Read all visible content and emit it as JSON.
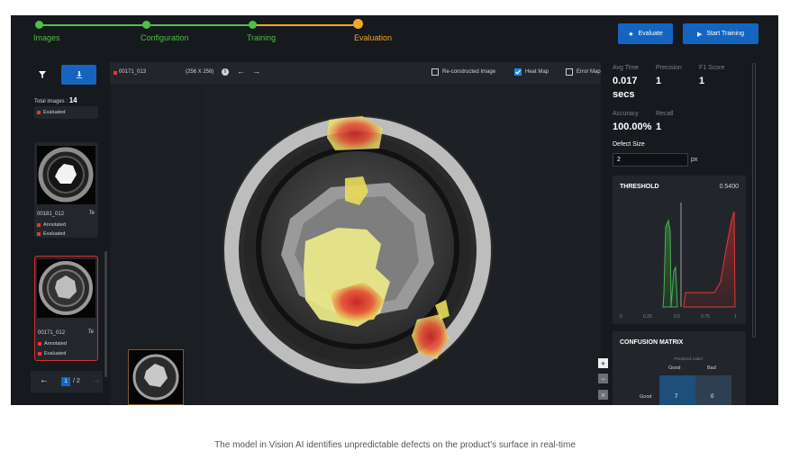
{
  "stepper": {
    "steps": [
      {
        "label": "Images",
        "status": "done"
      },
      {
        "label": "Configuration",
        "status": "done"
      },
      {
        "label": "Training",
        "status": "done"
      },
      {
        "label": "Evaluation",
        "status": "active"
      }
    ],
    "evaluate_label": "Evaluate",
    "start_training_label": "Start Training"
  },
  "sidebar": {
    "total_label": "Total images :",
    "total_count": "14",
    "cards": [
      {
        "name": "",
        "tags": [
          "Evaluated"
        ]
      },
      {
        "name": "00181_012",
        "suffix": "Te",
        "tags": [
          "Annotated",
          "Evaluated"
        ]
      },
      {
        "name": "00171_012",
        "suffix": "Te",
        "tags": [
          "Annotated",
          "Evaluated"
        ],
        "selected": true
      }
    ],
    "pagination": {
      "current": "1",
      "total": "/ 2"
    }
  },
  "viewer": {
    "file_name": "00171_013",
    "dimensions": "(256 X 256)",
    "options": [
      {
        "label": "Re-constructed Image",
        "checked": false
      },
      {
        "label": "Heat Map",
        "checked": true
      },
      {
        "label": "Error Map",
        "checked": false
      }
    ],
    "zoom_in": "+",
    "zoom_out": "−",
    "fit": "×"
  },
  "metrics": {
    "avg_time_label": "Avg Time",
    "avg_time_value": "0.017",
    "avg_time_unit": "secs",
    "precision_label": "Precision",
    "precision_value": "1",
    "f1_label": "F1 Score",
    "f1_value": "1",
    "accuracy_label": "Accuracy",
    "accuracy_value": "100.00%",
    "recall_label": "Recall",
    "recall_value": "1",
    "defect_size_label": "Defect Size",
    "defect_size_value": "2",
    "defect_size_unit": "px"
  },
  "threshold": {
    "title": "THRESHOLD",
    "value": "0.5400",
    "ticks": [
      "0",
      "0.25",
      "0.5",
      "0.75",
      "1"
    ],
    "colors": {
      "good": "#43a047",
      "bad": "#e53935"
    }
  },
  "confusion": {
    "title": "CONFUSION MATRIX",
    "predicted_label": "Predicted Label",
    "cols": [
      "Good",
      "Bad"
    ],
    "rows": [
      {
        "label": "Good",
        "values": [
          "7",
          "0"
        ]
      }
    ]
  },
  "caption": "The model in Vision AI identifies unpredictable defects on the product's surface in real-time"
}
